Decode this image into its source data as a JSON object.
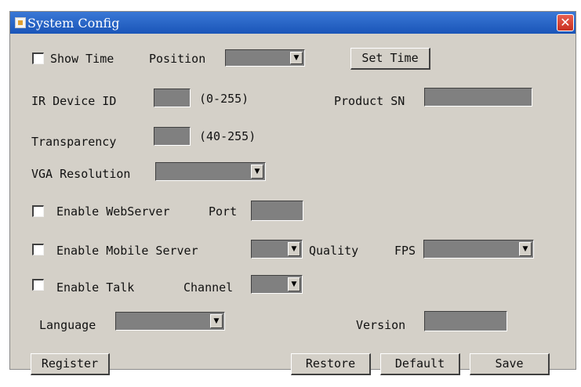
{
  "window": {
    "title": "System Config",
    "close_label": "✕"
  },
  "show_time": {
    "checkbox_label": "Show Time",
    "position_label": "Position",
    "position_value": "",
    "set_time_button": "Set Time"
  },
  "ir_device": {
    "label": "IR Device ID",
    "value": "",
    "range": "(0-255)"
  },
  "product_sn": {
    "label": "Product SN",
    "value": ""
  },
  "transparency": {
    "label": "Transparency",
    "value": "",
    "range": "(40-255)"
  },
  "vga": {
    "label": "VGA Resolution",
    "value": ""
  },
  "webserver": {
    "checkbox_label": "Enable WebServer",
    "port_label": "Port",
    "port_value": ""
  },
  "mobile_server": {
    "checkbox_label": "Enable Mobile Server",
    "value": "",
    "quality_label": "Quality",
    "fps_label": "FPS",
    "fps_value": ""
  },
  "talk": {
    "checkbox_label": "Enable Talk",
    "channel_label": "Channel",
    "channel_value": ""
  },
  "language": {
    "label": "Language",
    "value": ""
  },
  "version": {
    "label": "Version",
    "value": ""
  },
  "buttons": {
    "register": "Register",
    "restore": "Restore",
    "default": "Default",
    "save": "Save"
  },
  "icons": {
    "window_icon": "app-icon",
    "close_icon": "close-icon",
    "dropdown_icon": "dropdown-arrow-icon"
  },
  "colors": {
    "titlebar": "#2a66c8",
    "window_bg": "#d4d0c8",
    "field_bg": "#808080",
    "close": "#d84030"
  }
}
